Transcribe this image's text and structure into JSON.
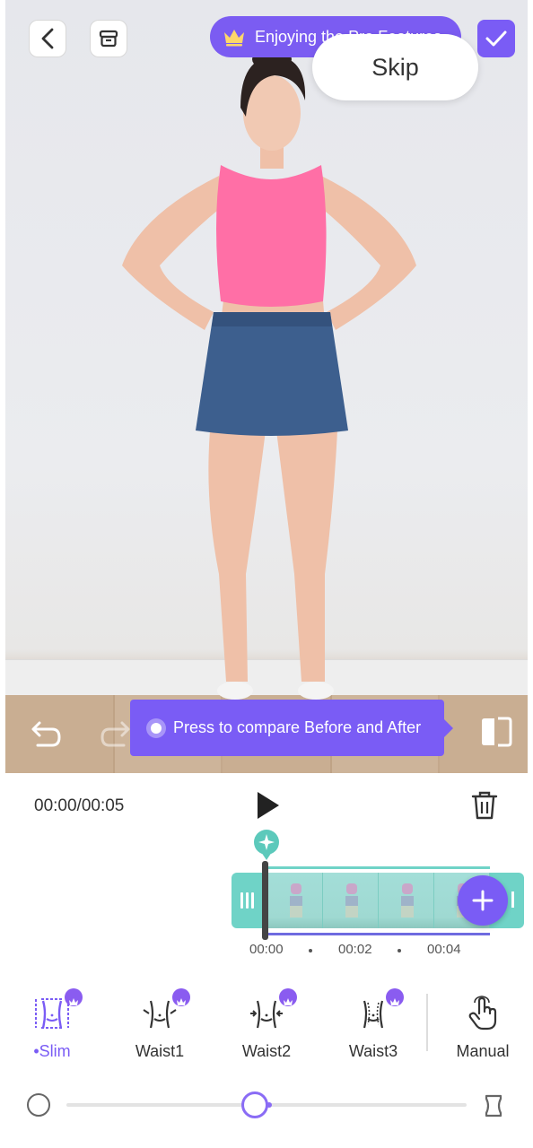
{
  "header": {
    "promo_text": "Enjoying the Pro Features",
    "skip_label": "Skip"
  },
  "preview": {
    "compare_hint": "Press to compare Before and After"
  },
  "player": {
    "time": "00:00/00:05"
  },
  "timeline": {
    "ticks": [
      "00:00",
      "00:02",
      "00:04"
    ]
  },
  "tools": [
    {
      "label": "•Slim",
      "icon": "slim-body-icon",
      "pro": true,
      "active": true
    },
    {
      "label": "Waist1",
      "icon": "waist-icon",
      "pro": true,
      "active": false
    },
    {
      "label": "Waist2",
      "icon": "waist-icon",
      "pro": true,
      "active": false
    },
    {
      "label": "Waist3",
      "icon": "waist-icon",
      "pro": true,
      "active": false
    },
    {
      "label": "Manual",
      "icon": "hand-pointer-icon",
      "pro": false,
      "active": false
    }
  ],
  "slider": {
    "value": 0.47
  },
  "colors": {
    "accent": "#7a5cf5",
    "timeline": "#6fd3c7"
  }
}
